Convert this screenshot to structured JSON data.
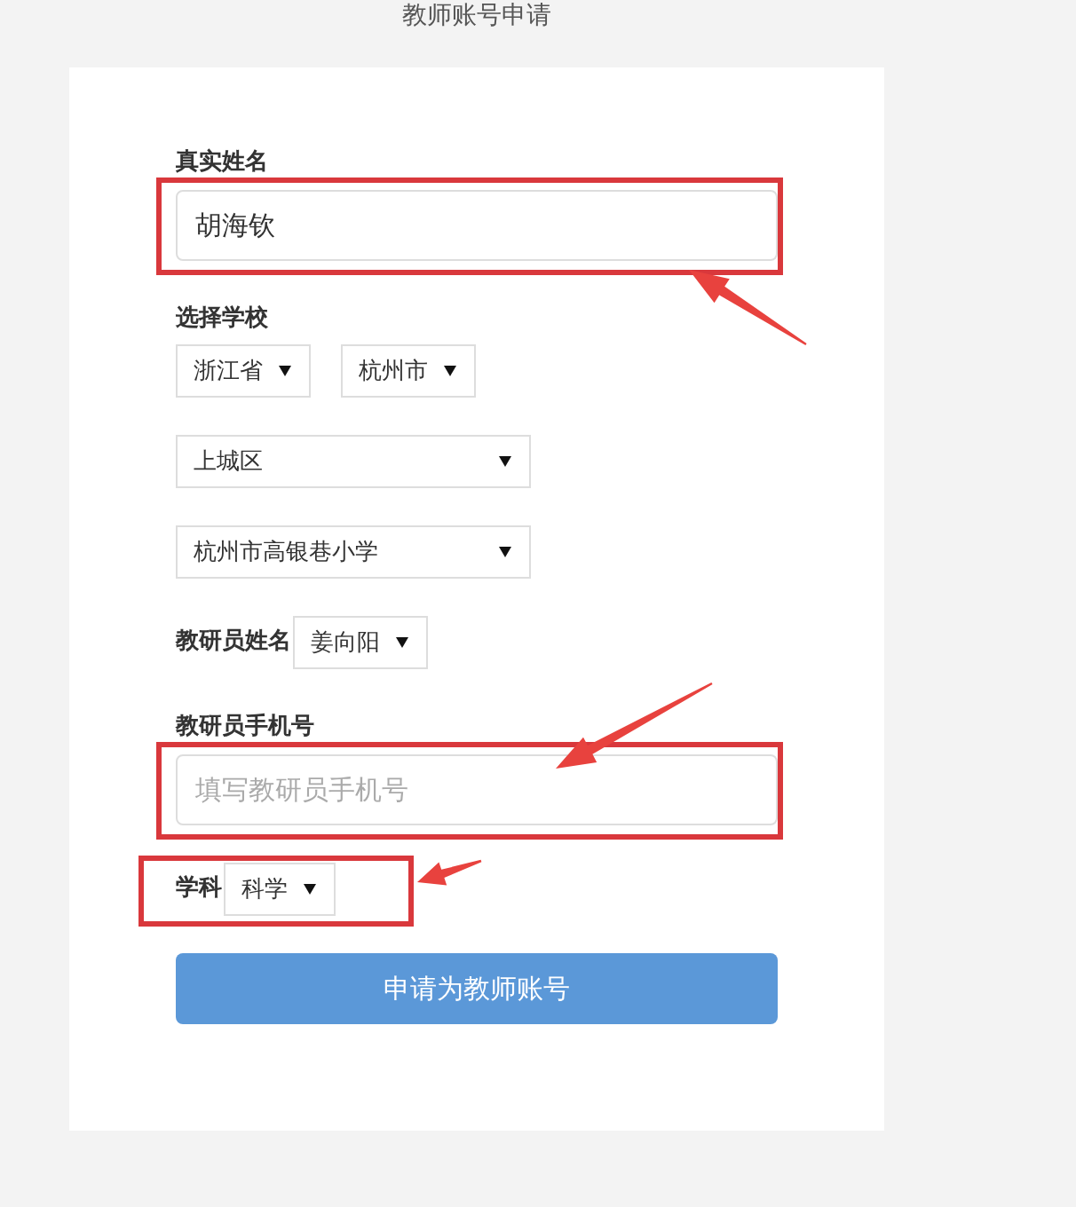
{
  "header": {
    "title": "教师账号申请"
  },
  "form": {
    "rows": [
      {
        "kind": "text",
        "label": "真实姓名",
        "value": "胡海钦",
        "highlighted": true,
        "arrow": {
          "kind": "up-left"
        }
      },
      {
        "kind": "heading",
        "label": "选择学校"
      },
      {
        "kind": "selects",
        "selects": [
          "浙江省",
          "杭州市"
        ]
      },
      {
        "kind": "selects",
        "selects": [
          "上城区"
        ]
      },
      {
        "kind": "selects",
        "selects": [
          "杭州市高银巷小学"
        ]
      },
      {
        "kind": "inline-select",
        "label": "教研员姓名",
        "value": "姜向阳",
        "highlighted": false
      },
      {
        "kind": "text",
        "label": "教研员手机号",
        "placeholder": "填写教研员手机号",
        "highlighted": true,
        "arrow": {
          "kind": "down-left"
        }
      },
      {
        "kind": "inline-select",
        "label": "学科",
        "value": "科学",
        "highlighted": true,
        "arrow": {
          "kind": "left"
        }
      }
    ],
    "submit": "申请为教师账号"
  }
}
